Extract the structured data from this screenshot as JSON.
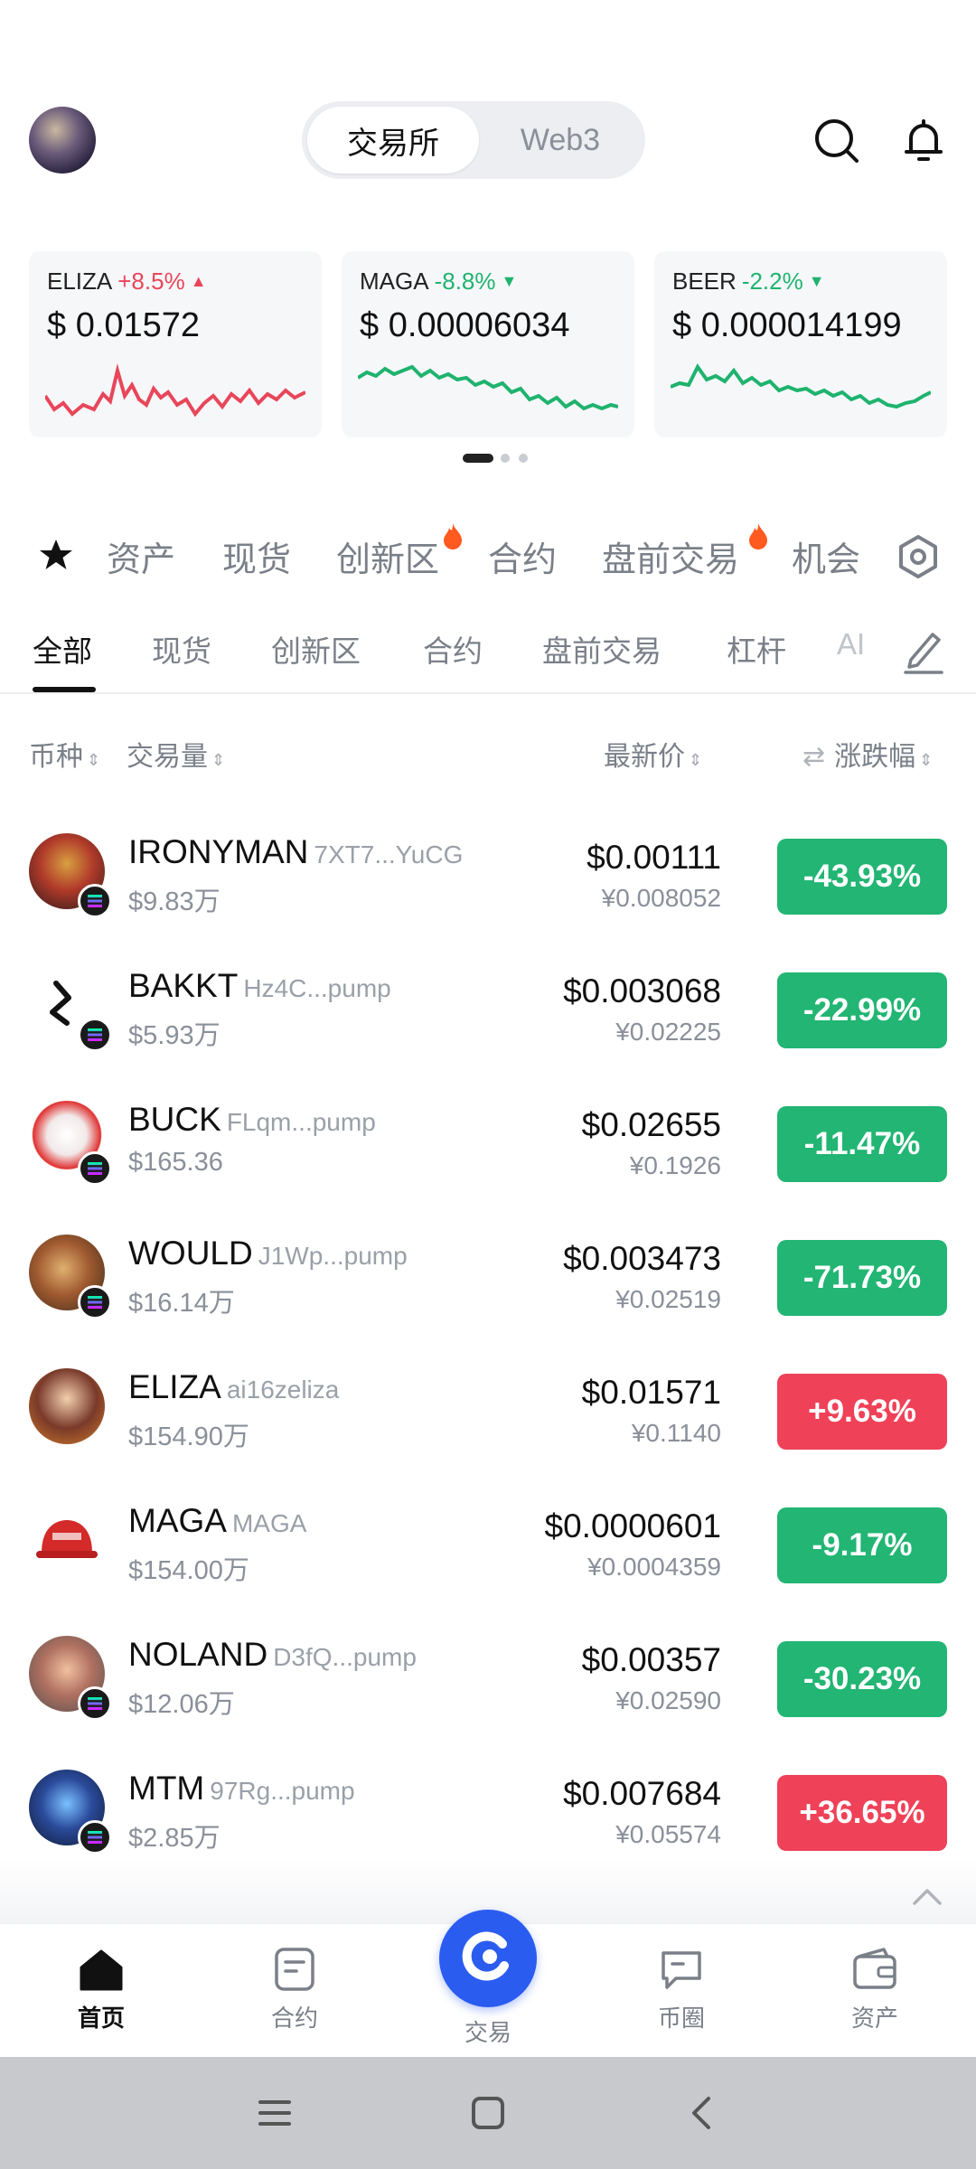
{
  "header": {
    "segment": [
      "交易所",
      "Web3"
    ],
    "active_segment": "交易所"
  },
  "tickers": [
    {
      "symbol": "ELIZA",
      "change": "+8.5%",
      "direction": "up",
      "price": "$ 0.01572"
    },
    {
      "symbol": "MAGA",
      "change": "-8.8%",
      "direction": "down",
      "price": "$ 0.00006034"
    },
    {
      "symbol": "BEER",
      "change": "-2.2%",
      "direction": "down",
      "price": "$ 0.000014199"
    }
  ],
  "category_tabs": [
    "资产",
    "现货",
    "创新区",
    "合约",
    "盘前交易",
    "机会"
  ],
  "sub_tabs": [
    "全部",
    "现货",
    "创新区",
    "合约",
    "盘前交易",
    "杠杆",
    "AI"
  ],
  "active_sub_tab": "全部",
  "columns": {
    "coin": "币种",
    "volume": "交易量",
    "last_price": "最新价",
    "change": "涨跌幅"
  },
  "rows": [
    {
      "symbol": "IRONYMAN",
      "address": "7XT7...YuCG",
      "volume": "$9.83万",
      "price": "$0.00111",
      "cny": "¥0.008052",
      "change": "-43.93%",
      "direction": "down"
    },
    {
      "symbol": "BAKKT",
      "address": "Hz4C...pump",
      "volume": "$5.93万",
      "price": "$0.003068",
      "cny": "¥0.02225",
      "change": "-22.99%",
      "direction": "down"
    },
    {
      "symbol": "BUCK",
      "address": "FLqm...pump",
      "volume": "$165.36",
      "price": "$0.02655",
      "cny": "¥0.1926",
      "change": "-11.47%",
      "direction": "down"
    },
    {
      "symbol": "WOULD",
      "address": "J1Wp...pump",
      "volume": "$16.14万",
      "price": "$0.003473",
      "cny": "¥0.02519",
      "change": "-71.73%",
      "direction": "down"
    },
    {
      "symbol": "ELIZA",
      "address": "ai16zeliza",
      "volume": "$154.90万",
      "price": "$0.01571",
      "cny": "¥0.1140",
      "change": "+9.63%",
      "direction": "up"
    },
    {
      "symbol": "MAGA",
      "address": "MAGA",
      "volume": "$154.00万",
      "price": "$0.0000601",
      "cny": "¥0.0004359",
      "change": "-9.17%",
      "direction": "down"
    },
    {
      "symbol": "NOLAND",
      "address": "D3fQ...pump",
      "volume": "$12.06万",
      "price": "$0.00357",
      "cny": "¥0.02590",
      "change": "-30.23%",
      "direction": "down"
    },
    {
      "symbol": "MTM",
      "address": "97Rg...pump",
      "volume": "$2.85万",
      "price": "$0.007684",
      "cny": "¥0.05574",
      "change": "+36.65%",
      "direction": "up"
    }
  ],
  "bottom_nav": [
    "首页",
    "合约",
    "交易",
    "币圈",
    "资产"
  ],
  "active_bottom": "首页",
  "colors": {
    "up": "#ef4158",
    "down": "#22b573",
    "accent": "#2b5cf0"
  }
}
